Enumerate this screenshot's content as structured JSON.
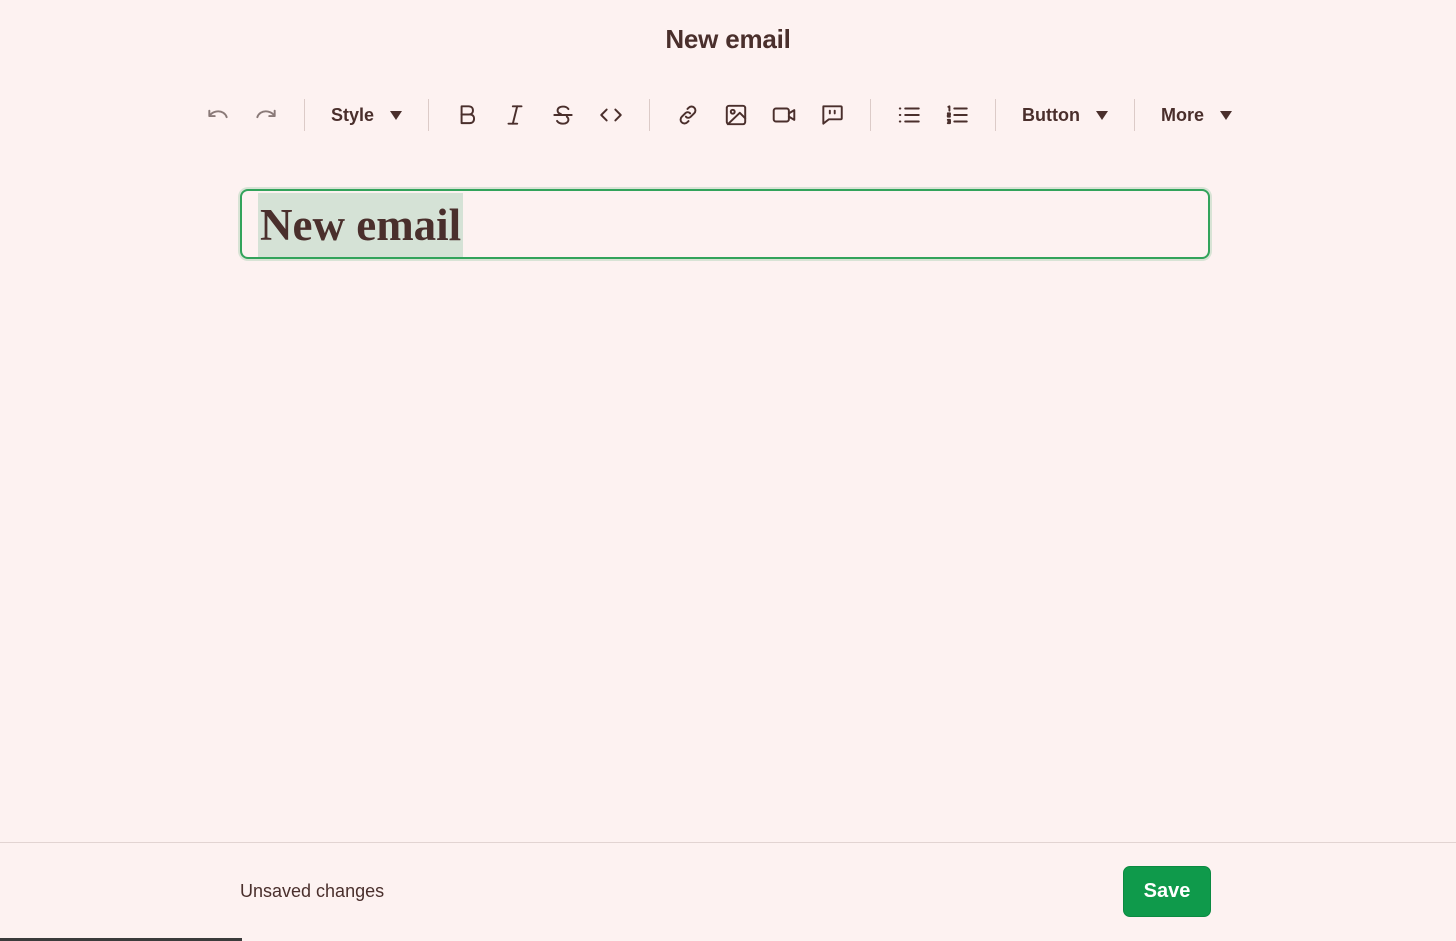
{
  "header": {
    "title": "New email"
  },
  "toolbar": {
    "undo_icon": "undo-icon",
    "redo_icon": "redo-icon",
    "style_label": "Style",
    "bold_icon": "bold-icon",
    "italic_icon": "italic-icon",
    "strikethrough_icon": "strikethrough-icon",
    "code_icon": "code-icon",
    "link_icon": "link-icon",
    "image_icon": "image-icon",
    "video_icon": "video-icon",
    "quote_icon": "quote-icon",
    "bullet_list_icon": "bullet-list-icon",
    "numbered_list_icon": "numbered-list-icon",
    "button_label": "Button",
    "more_label": "More"
  },
  "editor": {
    "title_value": "New email",
    "title_selected": true
  },
  "footer": {
    "status": "Unsaved changes",
    "save_label": "Save"
  },
  "colors": {
    "background": "#fdf2f1",
    "text": "#4a2f2c",
    "accent_green": "#0f9a4b",
    "selection": "#d5e2d6",
    "focus_border": "#32a35b"
  }
}
